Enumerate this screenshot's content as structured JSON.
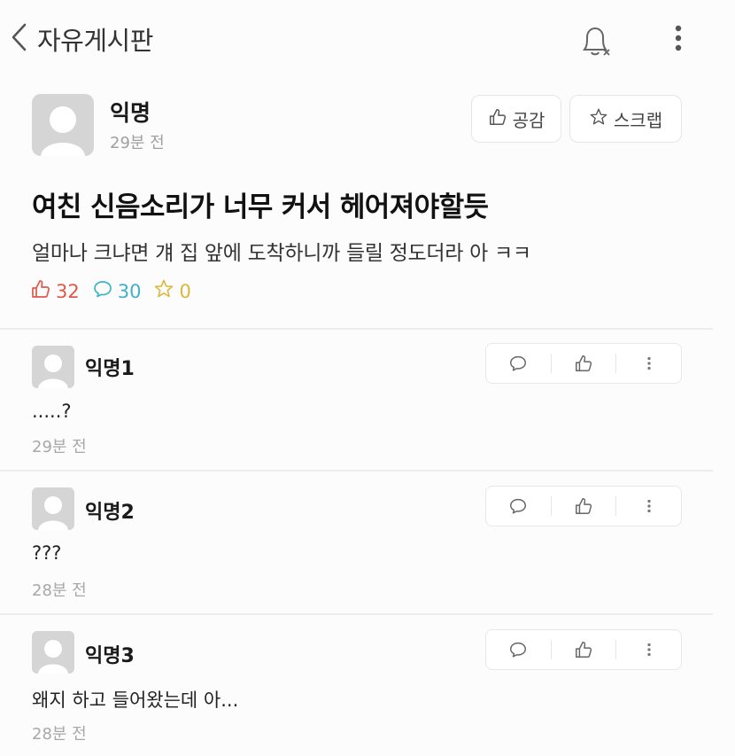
{
  "header": {
    "back_label": "자유게시판",
    "icons": [
      "chevron-left-icon",
      "bell-off-icon",
      "more-vertical-icon"
    ]
  },
  "post": {
    "author": "익명",
    "time": "29분 전",
    "like_button": "공감",
    "scrap_button": "스크랩",
    "title": "여친 신음소리가 너무 커서 헤어져야할듯",
    "body": "얼마나 크냐면 걔 집 앞에 도착하니까 들릴 정도더라 아 ㅋㅋ",
    "stats": {
      "likes": "32",
      "comments": "30",
      "scraps": "0"
    },
    "colors": {
      "like": "#e0584a",
      "comment": "#3fb1c9",
      "scrap": "#d9b93a"
    }
  },
  "comments": [
    {
      "author": "익명1",
      "text": ".....?",
      "time": "29분 전"
    },
    {
      "author": "익명2",
      "text": "???",
      "time": "28분 전"
    },
    {
      "author": "익명3",
      "text": "왜지 하고 들어왔는데 아...",
      "time": "28분 전"
    }
  ]
}
